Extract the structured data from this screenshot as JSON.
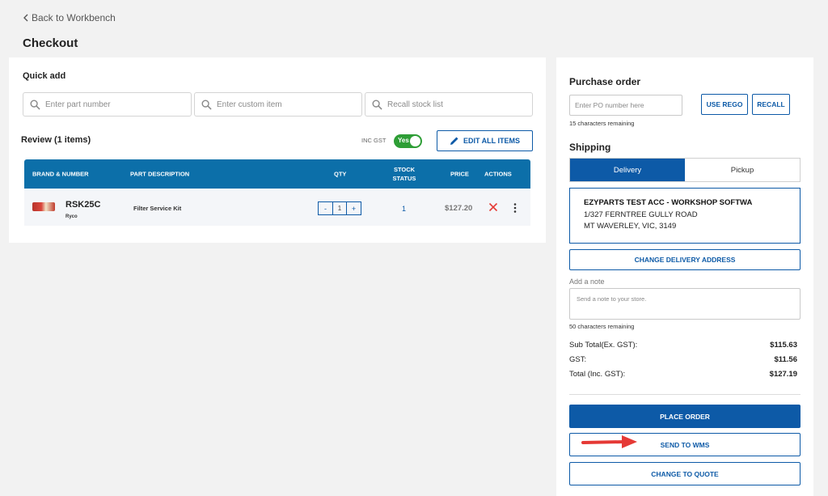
{
  "nav": {
    "back_label": "Back to Workbench"
  },
  "page": {
    "title": "Checkout"
  },
  "quick_add": {
    "title": "Quick add",
    "inputs": [
      {
        "placeholder": "Enter part number",
        "icon": "search-icon"
      },
      {
        "placeholder": "Enter custom item",
        "icon": "search-icon"
      },
      {
        "placeholder": "Recall stock list",
        "icon": "search-icon"
      }
    ]
  },
  "review": {
    "title": "Review (1 items)",
    "gst_label": "INC GST",
    "gst_toggle": "Yes",
    "edit_all_label": "EDIT ALL ITEMS"
  },
  "table": {
    "headers": {
      "brand": "BRAND & NUMBER",
      "description": "PART DESCRIPTION",
      "qty": "QTY",
      "stock": "STOCK STATUS",
      "price": "PRICE",
      "actions": "ACTIONS"
    },
    "rows": [
      {
        "part_number": "RSK25C",
        "brand": "Ryco",
        "description": "Filter Service Kit",
        "qty_minus": "-",
        "qty": "1",
        "qty_plus": "+",
        "stock": "1",
        "price": "$127.20"
      }
    ]
  },
  "purchase_order": {
    "title": "Purchase order",
    "placeholder": "Enter PO number here",
    "use_rego_label": "USE REGO",
    "recall_label": "RECALL",
    "remaining": "15 characters remaining"
  },
  "shipping": {
    "title": "Shipping",
    "tabs": [
      {
        "label": "Delivery",
        "active": true
      },
      {
        "label": "Pickup",
        "active": false
      }
    ],
    "address": {
      "name": "EZYPARTS TEST ACC - WORKSHOP SOFTWA",
      "line1": "1/327 FERNTREE GULLY ROAD",
      "line2": "MT WAVERLEY, VIC, 3149"
    },
    "change_address_label": "CHANGE DELIVERY ADDRESS"
  },
  "note": {
    "label": "Add a note",
    "placeholder": "Send a note to your store.",
    "remaining": "50 characters remaining"
  },
  "totals": {
    "subtotal_label": "Sub Total(Ex. GST):",
    "subtotal": "$115.63",
    "gst_label": "GST:",
    "gst": "$11.56",
    "total_label": "Total (Inc. GST):",
    "total": "$127.19"
  },
  "actions": {
    "place_order": "PLACE ORDER",
    "send_to_wms": "SEND TO WMS",
    "change_to_quote": "CHANGE TO QUOTE"
  },
  "colors": {
    "primary": "#0d5aa7",
    "table_header": "#0c6fa9",
    "toggle_on": "#2e9e36",
    "annotation_arrow": "#e53935"
  }
}
